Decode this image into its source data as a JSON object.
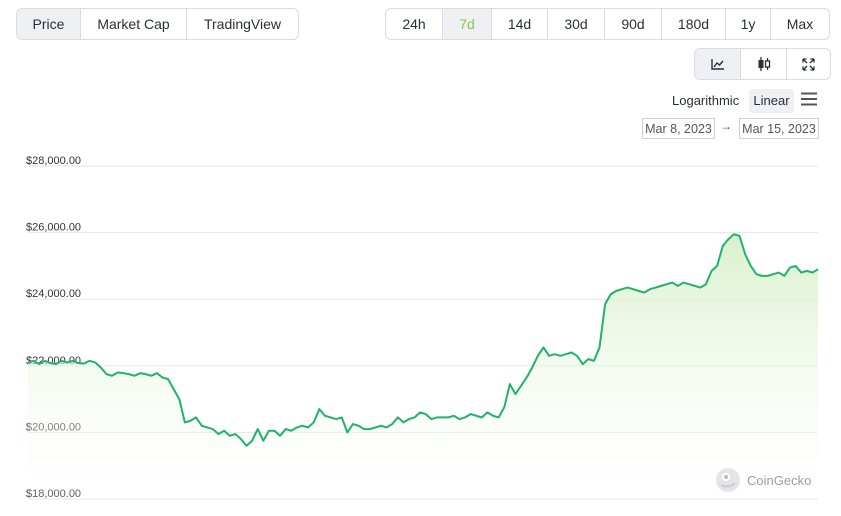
{
  "tabs": {
    "views": [
      "Price",
      "Market Cap",
      "TradingView"
    ],
    "active_view": 0,
    "ranges": [
      "24h",
      "7d",
      "14d",
      "30d",
      "90d",
      "180d",
      "1y",
      "Max"
    ],
    "active_range": 1
  },
  "chart_types": [
    {
      "icon": "line-chart-icon",
      "active": true
    },
    {
      "icon": "candlestick-icon",
      "active": false
    },
    {
      "icon": "fullscreen-icon",
      "active": false
    }
  ],
  "scale": {
    "logarithmic": "Logarithmic",
    "linear": "Linear",
    "active": "Linear"
  },
  "date_range": {
    "from": "Mar 8, 2023",
    "arrow": "→",
    "to": "Mar 15, 2023"
  },
  "watermark": {
    "text": "CoinGecko"
  },
  "colors": {
    "line": "#21b26b",
    "area_top": "#d5efc6",
    "active_range": "#8dc647",
    "grid": "#e6e6e6"
  },
  "chart_data": {
    "type": "area",
    "title": "",
    "xlabel": "",
    "ylabel": "",
    "ylim": [
      18000,
      28000
    ],
    "ytick_labels": [
      "$28,000.00",
      "$26,000.00",
      "$24,000.00",
      "$22,000.00",
      "$20,000.00",
      "$18,000.00"
    ],
    "ytick_values": [
      28000,
      26000,
      24000,
      22000,
      20000,
      18000
    ],
    "x_range": [
      "2023-03-08",
      "2023-03-15"
    ],
    "series": [
      {
        "values": [
          22100,
          22150,
          22050,
          22150,
          22080,
          22050,
          22150,
          22100,
          22150,
          22080,
          22070,
          22150,
          22100,
          21950,
          21750,
          21700,
          21800,
          21780,
          21750,
          21700,
          21780,
          21750,
          21700,
          21780,
          21650,
          21600,
          21300,
          21000,
          20300,
          20350,
          20450,
          20200,
          20150,
          20100,
          19950,
          20050,
          19900,
          19950,
          19800,
          19600,
          19750,
          20100,
          19750,
          20050,
          20050,
          19900,
          20100,
          20050,
          20150,
          20200,
          20150,
          20300,
          20700,
          20500,
          20450,
          20400,
          20450,
          20000,
          20250,
          20200,
          20100,
          20100,
          20150,
          20200,
          20150,
          20250,
          20450,
          20300,
          20400,
          20450,
          20600,
          20550,
          20400,
          20450,
          20450,
          20450,
          20500,
          20400,
          20450,
          20550,
          20500,
          20450,
          20600,
          20500,
          20450,
          20750,
          21450,
          21150,
          21400,
          21650,
          21950,
          22300,
          22550,
          22300,
          22350,
          22300,
          22350,
          22400,
          22300,
          22050,
          22200,
          22150,
          22550,
          23850,
          24150,
          24250,
          24300,
          24350,
          24300,
          24250,
          24200,
          24300,
          24350,
          24400,
          24450,
          24500,
          24400,
          24500,
          24450,
          24400,
          24350,
          24450,
          24850,
          25000,
          25600,
          25800,
          25950,
          25900,
          25350,
          25000,
          24750,
          24700,
          24700,
          24750,
          24800,
          24700,
          24950,
          25000,
          24800,
          24850,
          24800,
          24900
        ]
      }
    ],
    "grid": true,
    "legend": "none"
  }
}
